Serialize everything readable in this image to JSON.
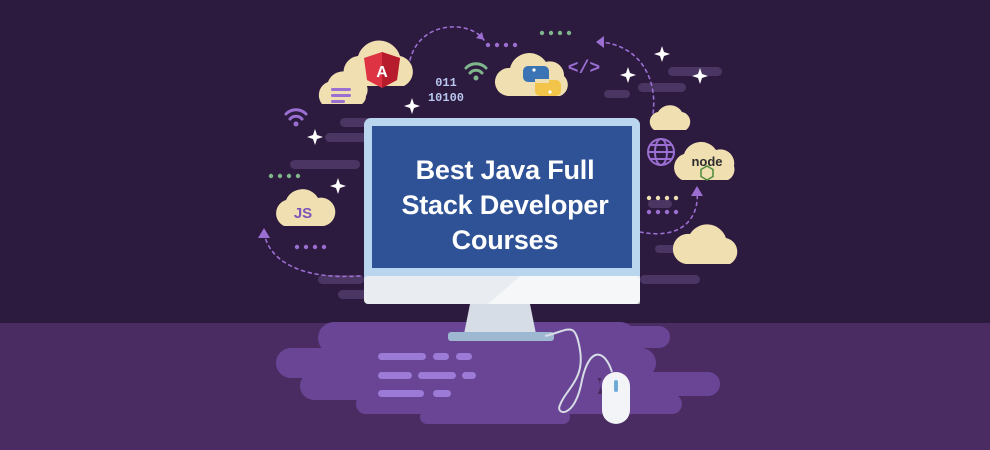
{
  "banner": {
    "title_lines": [
      "Best Java Full",
      "Stack Developer",
      "Courses"
    ]
  },
  "badges": {
    "js": "JS",
    "node": "node",
    "angular": "A",
    "code_tag": "</>",
    "binary_line1": "011",
    "binary_line2": "10100"
  },
  "colors": {
    "background": "#2d1a3f",
    "floor": "#4a2c63",
    "screen": "#2f5296",
    "monitor_frame": "#b9d6ee",
    "cloud": "#f0dfb0",
    "accent_purple": "#9a6fd1",
    "accent_green": "#7fb58a"
  },
  "icons": [
    "wifi-icon",
    "sparkle-icon",
    "globe-icon",
    "python-icon",
    "angular-icon",
    "mouse-icon",
    "arrow-icon"
  ]
}
